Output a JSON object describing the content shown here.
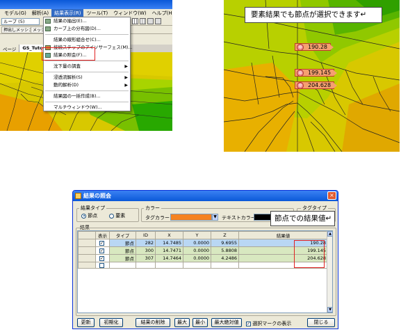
{
  "panel1": {
    "menubar": [
      "モデル(G)",
      "解析(A)",
      "結果表示(R)",
      "ツール(T)",
      "ウィンドウ(W)",
      "ヘルプ(H)"
    ],
    "combo": "ループ (5)",
    "toolbar2": [
      "押出しメッシュ",
      "メッシュ"
    ],
    "tabs": [
      "ページ",
      "GS_Tutorial"
    ],
    "menu_items": [
      "結果の抽出(E)...",
      "カーブ上の分布図(D)...",
      "結果の線形組合せ(C)...",
      "接続ステップのアイソサーフェス(M)...",
      "結果の照会(F)...",
      "沈下量の調査",
      "浸透流解析(S)",
      "動的解析(D)",
      "結果図の一括作成(B)...",
      "マルチウィンドウ(W)..."
    ]
  },
  "panel2": {
    "callout": "要素結果でも節点が選択できます↵",
    "tags": [
      "190.28",
      "199.145",
      "204.628"
    ]
  },
  "dialog": {
    "title": "結果の照会",
    "close": "×",
    "result_type_label": "結果タイプ",
    "radio_node": "節点",
    "radio_element": "要素",
    "color_label": "カラー",
    "tag_color_label": "タグカラー",
    "text_color_label": "テキストカラー",
    "tag_type_label": "タグタイプ",
    "results_label": "結果",
    "callout": "節点での結果値↵",
    "headers": [
      "",
      "表示",
      "タイプ",
      "ID",
      "X",
      "Y",
      "Z",
      "結果値"
    ],
    "rows": [
      {
        "type": "節点",
        "id": "282",
        "x": "14.7485",
        "y": "0.0000",
        "z": "9.6955",
        "value": "190.28"
      },
      {
        "type": "節点",
        "id": "300",
        "x": "14.7471",
        "y": "0.0000",
        "z": "5.8808",
        "value": "199.145"
      },
      {
        "type": "節点",
        "id": "307",
        "x": "14.7464",
        "y": "0.0000",
        "z": "4.2486",
        "value": "204.628"
      }
    ],
    "buttons": [
      "更新",
      "初期化",
      "結果の削除",
      "最大",
      "最小",
      "最大絶対値"
    ],
    "checkbox_label": "選択マークの表示",
    "close_button": "閉じる",
    "colors": {
      "tag_color": "#f58220",
      "text_color": "#000000"
    }
  }
}
